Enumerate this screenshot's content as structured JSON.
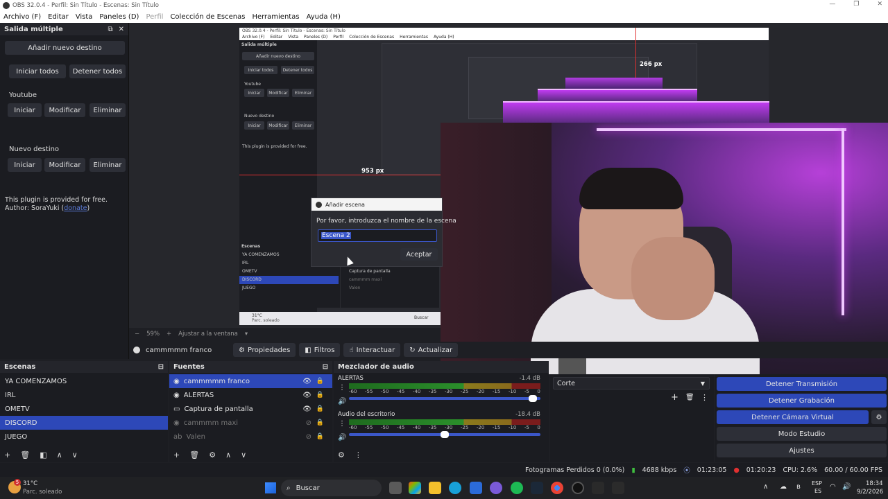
{
  "window": {
    "title": "OBS 32.0.4 - Perfil: Sin Título - Escenas: Sin Título",
    "controls": [
      "—",
      "❐",
      "✕"
    ]
  },
  "menu": [
    "Archivo (F)",
    "Editar",
    "Vista",
    "Paneles (D)",
    "Perfil",
    "Colección de Escenas",
    "Herramientas",
    "Ayuda (H)"
  ],
  "multioutput": {
    "title": "Salida múltiple",
    "add_target": "Añadir nuevo destino",
    "start_all": "Iniciar todos",
    "stop_all": "Detener todos",
    "targets": [
      {
        "name": "Youtube",
        "start": "Iniciar",
        "edit": "Modificar",
        "delete": "Eliminar"
      },
      {
        "name": "Nuevo destino",
        "start": "Iniciar",
        "edit": "Modificar",
        "delete": "Eliminar"
      }
    ],
    "note_line1": "This plugin is provided for free.",
    "note_line2_prefix": "Author: SoraYuki (",
    "note_link": "donate",
    "note_line2_suffix": ")"
  },
  "preview": {
    "measure_left": "953 px",
    "measure_top": "266 px",
    "nested_title": "OBS 32.0.4 - Perfil: Sin Título - Escenas: Sin Título",
    "nested_menu": [
      "Archivo (F)",
      "Editar",
      "Vista",
      "Paneles (D)",
      "Perfil",
      "Colección de Escenas",
      "Herramientas",
      "Ayuda (H)"
    ],
    "nested_scenes_header": "Escenas",
    "nested_scenes": [
      "YA COMENZAMOS",
      "IRL",
      "OMETV",
      "DISCORD",
      "JUEGO"
    ],
    "nested_sources": [
      "Captura de pantalla",
      "cammmm maxi",
      "Valen"
    ],
    "nested_taskbar_temp": "31°C",
    "nested_taskbar_weather": "Parc. soleado",
    "nested_search": "Buscar"
  },
  "dialog": {
    "title": "Añadir escena",
    "prompt": "Por favor, introduzca el nombre de la escena",
    "value": "Escena 2",
    "accept": "Aceptar"
  },
  "zoom": {
    "level": "59%",
    "fit": "Ajustar a la ventana"
  },
  "source_toolbar": {
    "current": "cammmmm franco",
    "properties": "Propiedades",
    "filters": "Filtros",
    "interact": "Interactuar",
    "refresh": "Actualizar"
  },
  "scenes": {
    "title": "Escenas",
    "items": [
      "YA COMENZAMOS",
      "IRL",
      "OMETV",
      "DISCORD",
      "JUEGO"
    ],
    "selected": 3
  },
  "sources": {
    "title": "Fuentes",
    "items": [
      {
        "name": "cammmmm franco",
        "icon": "browser-icon",
        "visible": true,
        "selected": true
      },
      {
        "name": "ALERTAS",
        "icon": "browser-icon",
        "visible": true,
        "selected": false
      },
      {
        "name": "Captura de pantalla",
        "icon": "monitor-icon",
        "visible": true,
        "selected": false
      },
      {
        "name": "cammmm maxi",
        "icon": "browser-icon",
        "visible": false,
        "selected": false
      },
      {
        "name": "Valen",
        "icon": "text-icon",
        "visible": false,
        "selected": false
      }
    ]
  },
  "mixer": {
    "title": "Mezclador de audio",
    "channels": [
      {
        "name": "ALERTAS",
        "db": "-1.4 dB",
        "volume": 0.96
      },
      {
        "name": "Audio del escritorio",
        "db": "-18.4 dB",
        "volume": 0.5
      }
    ],
    "ticks": [
      "-60",
      "-55",
      "-50",
      "-45",
      "-40",
      "-35",
      "-30",
      "-25",
      "-20",
      "-15",
      "-10",
      "-5",
      "0"
    ]
  },
  "transitions": {
    "selected": "Corte"
  },
  "controls": {
    "stop_stream": "Detener Transmisión",
    "stop_record": "Detener Grabación",
    "stop_vcam": "Detener Cámara Virtual",
    "studio_mode": "Modo Estudio",
    "settings": "Ajustes"
  },
  "status": {
    "dropped": "Fotogramas Perdidos 0 (0.0%)",
    "bitrate": "4688 kbps",
    "stream_time": "01:23:05",
    "rec_time": "01:20:23",
    "cpu": "CPU: 2.6%",
    "fps": "60.00 / 60.00 FPS"
  },
  "taskbar": {
    "temp": "31°C",
    "weather": "Parc. soleado",
    "search": "Buscar",
    "lang1": "ESP",
    "lang2": "ES",
    "time": "18:34",
    "date": "9/2/2026",
    "badge": "5"
  },
  "colors": {
    "accent": "#2d48b8",
    "live": "#e03030",
    "neon": "#d040f0"
  }
}
